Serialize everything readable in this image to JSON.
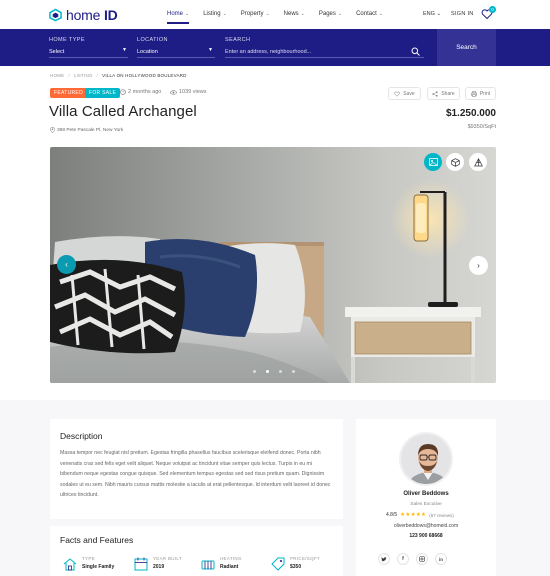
{
  "brand": {
    "name_light": "home",
    "name_bold": "ID"
  },
  "nav": {
    "items": [
      {
        "label": "Home"
      },
      {
        "label": "Listing"
      },
      {
        "label": "Property"
      },
      {
        "label": "News"
      },
      {
        "label": "Pages"
      },
      {
        "label": "Contact"
      }
    ],
    "language": "ENG",
    "signin": "SIGN IN",
    "favorites_count": "0"
  },
  "search": {
    "home_type_label": "HOME TYPE",
    "home_type_value": "Select",
    "location_label": "LOCATION",
    "location_value": "Location",
    "query_label": "SEARCH",
    "query_placeholder": "Enter an address, neighbourhood...",
    "button": "Search"
  },
  "breadcrumb": [
    "HOME",
    "LISTING",
    "VILLA ON HOLLYWOOD BOULEVARD"
  ],
  "listing": {
    "tags": [
      "FEATURED",
      "FOR SALE"
    ],
    "posted": "2 months ago",
    "views": "1039 views",
    "title": "Villa Called Archangel",
    "address": "398 Pete Pascale Pl, New York",
    "price": "$1.250.000",
    "price_per_sqft": "$9350/SqFt",
    "actions": {
      "save": "Save",
      "share": "Share",
      "print": "Print"
    },
    "gallery_dots": 4,
    "gallery_active_dot": 1
  },
  "description": {
    "title": "Description",
    "text": "Massa tempor nec feugiat nisl pretium. Egestas fringilla phasellus faucibus scelerisque eleifend donec. Porta nibh venenatis cras sed felis eget velit aliquet. Neque volutpat ac tincidunt vitae semper quis lectus. Turpis in eu mi bibendum neque egestas congue quisque. Sed elementum tempus egestas sed sed risus pretium quam. Dignissim sodales ut eu sem. Nibh mauris cursus mattis molestie a iaculis at erat pellentesque. Id interdum velit laoreet id donec ultrices tincidunt."
  },
  "facts": {
    "title": "Facts and Features",
    "items": [
      {
        "label": "TYPE",
        "value": "Single Family",
        "icon": "house-icon"
      },
      {
        "label": "YEAR BUILT",
        "value": "2019",
        "icon": "calendar-icon"
      },
      {
        "label": "HEATING",
        "value": "Radiant",
        "icon": "heating-icon"
      },
      {
        "label": "PRICE/SQFT",
        "value": "$350",
        "icon": "price-tag-icon"
      }
    ]
  },
  "agent": {
    "name": "Oliver Beddows",
    "role": "Sales Excutive",
    "rating": "4.8/5",
    "stars": "★★★★★",
    "reviews": "(67 reviews)",
    "email": "oliverbeddows@homeid.com",
    "phone": "123 900 68668",
    "socials": [
      "twitter-icon",
      "facebook-icon",
      "instagram-icon",
      "linkedin-icon"
    ]
  },
  "colors": {
    "primary": "#1e1d85",
    "accent": "#00b6c8",
    "featured": "#ff6935",
    "star": "#ffb800"
  }
}
